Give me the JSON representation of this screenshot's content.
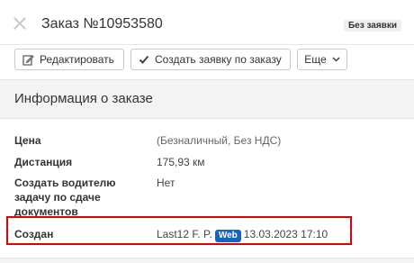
{
  "header": {
    "title": "Заказ №10953580",
    "badge": "Без заявки"
  },
  "toolbar": {
    "edit_label": "Редактировать",
    "create_request_label": "Создать заявку по заказу",
    "more_label": "Еще"
  },
  "section": {
    "title": "Информация о заказе"
  },
  "fields": {
    "price": {
      "label": "Цена",
      "value": "(Безналичный, Без НДС)"
    },
    "distance": {
      "label": "Дистанция",
      "value": "175,93 км"
    },
    "driver_task": {
      "label": "Создать водителю задачу по сдаче документов",
      "value": "Нет"
    },
    "created": {
      "label": "Создан",
      "user": "Last12 F. P.",
      "source": "Web",
      "datetime": "13.03.2023 17:10"
    }
  },
  "icons": {
    "close": "close-icon",
    "edit": "edit-icon",
    "check": "check-icon",
    "more": "chevron-down-icon"
  },
  "colors": {
    "highlight": "#e00000",
    "web_badge": "#1565c0"
  }
}
